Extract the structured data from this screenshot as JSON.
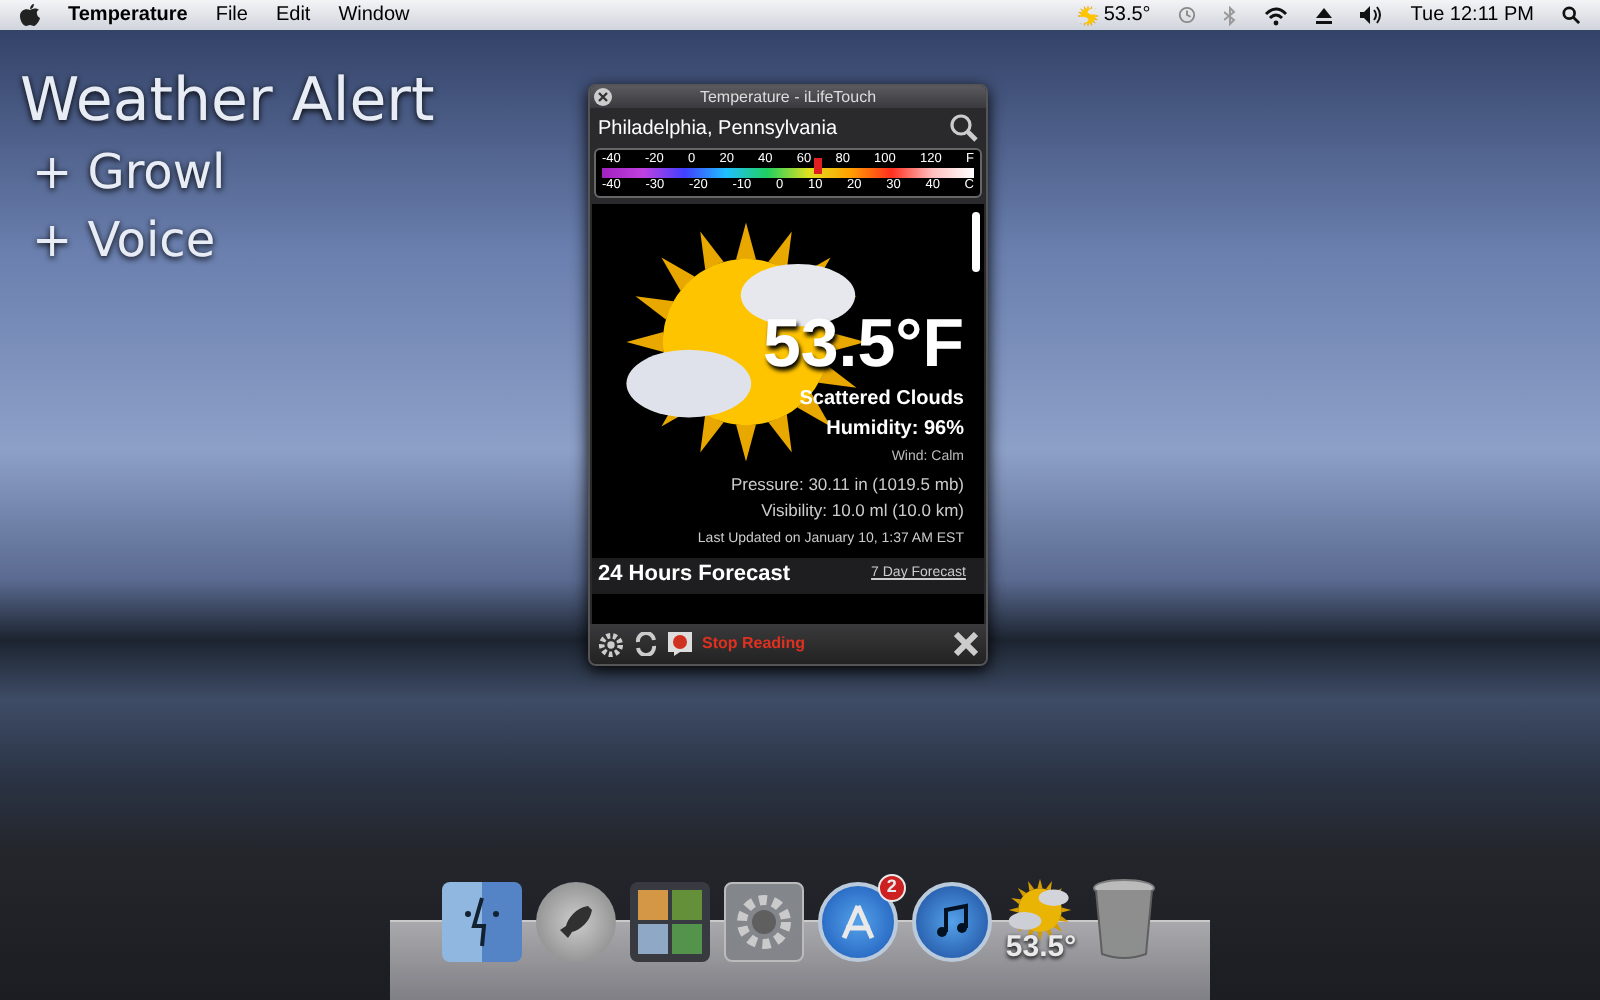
{
  "menu_bar": {
    "app_name": "Temperature",
    "menus": [
      "File",
      "Edit",
      "Window"
    ],
    "status_temp": "53.5°",
    "clock": "Tue 12:11 PM"
  },
  "overlay": {
    "title": "Weather Alert",
    "features": [
      "+ Growl",
      "+ Voice"
    ]
  },
  "widget": {
    "title": "Temperature - iLifeTouch",
    "location": "Philadelphia, Pennsylvania",
    "scale": {
      "fahrenheit": [
        "-40",
        "-20",
        "0",
        "20",
        "40",
        "60",
        "80",
        "100",
        "120"
      ],
      "unit_f": "F",
      "celsius": [
        "-40",
        "-30",
        "-20",
        "-10",
        "0",
        "10",
        "20",
        "30",
        "40"
      ],
      "unit_c": "C",
      "level": 0.58
    },
    "temperature": "53.5°F",
    "condition": "Scattered Clouds",
    "humidity": "Humidity: 96%",
    "wind": "Wind: Calm",
    "pressure": "Pressure: 30.11 in (1019.5 mb)",
    "visibility": "Visibility: 10.0 ml (10.0 km)",
    "updated": "Last Updated on January 10, 1:37 AM EST",
    "forecast_heading": "24 Hours Forecast",
    "forecast_link": "7 Day Forecast",
    "stop_reading": "Stop Reading"
  },
  "dock": [
    {
      "kind": "finder"
    },
    {
      "kind": "launchpad"
    },
    {
      "kind": "mission"
    },
    {
      "kind": "preferences"
    },
    {
      "kind": "appstore",
      "badge": "2"
    },
    {
      "kind": "music"
    },
    {
      "kind": "weather",
      "label": "53.5°"
    },
    {
      "kind": "trash"
    }
  ]
}
